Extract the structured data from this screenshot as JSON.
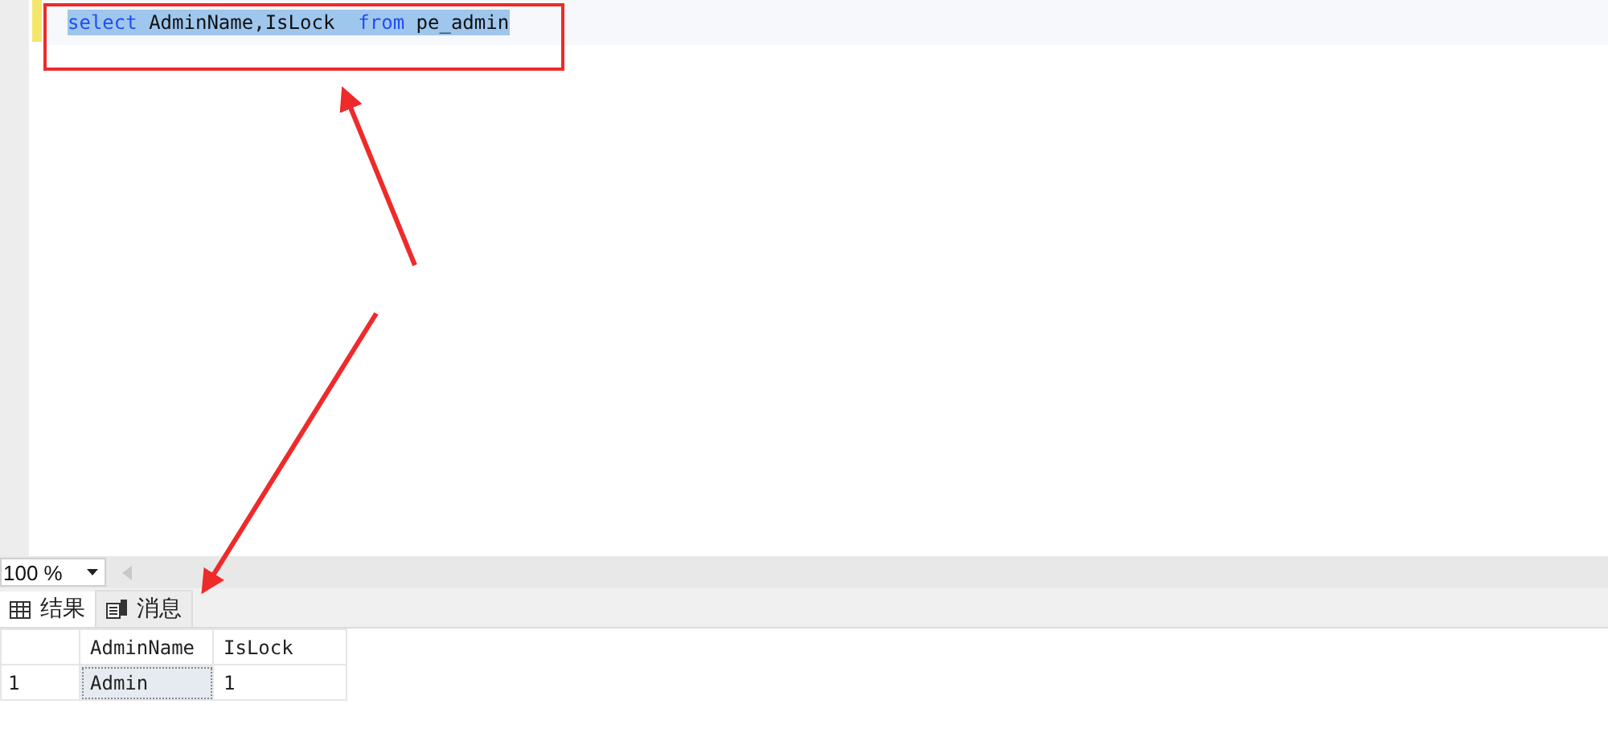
{
  "editor": {
    "lines": [
      {
        "selected": true,
        "tokens": [
          {
            "kind": "keyword",
            "text": "select"
          },
          {
            "kind": "plain",
            "text": " AdminName,IsLock  "
          },
          {
            "kind": "keyword",
            "text": "from"
          },
          {
            "kind": "plain",
            "text": " pe_admin"
          }
        ]
      }
    ]
  },
  "zoom": {
    "value": "100 %"
  },
  "tabs": [
    {
      "label": "结果",
      "kind": "grid",
      "selected": true
    },
    {
      "label": "消息",
      "kind": "message",
      "selected": false
    }
  ],
  "results": {
    "columns": [
      "AdminName",
      "IsLock"
    ],
    "rows": [
      {
        "number": "1",
        "cells": [
          {
            "text": "Admin",
            "selected": true
          },
          {
            "text": "1",
            "selected": false
          }
        ]
      }
    ]
  },
  "annotations": [
    {
      "kind": "frame"
    },
    {
      "kind": "arrow"
    },
    {
      "kind": "arrow"
    }
  ]
}
